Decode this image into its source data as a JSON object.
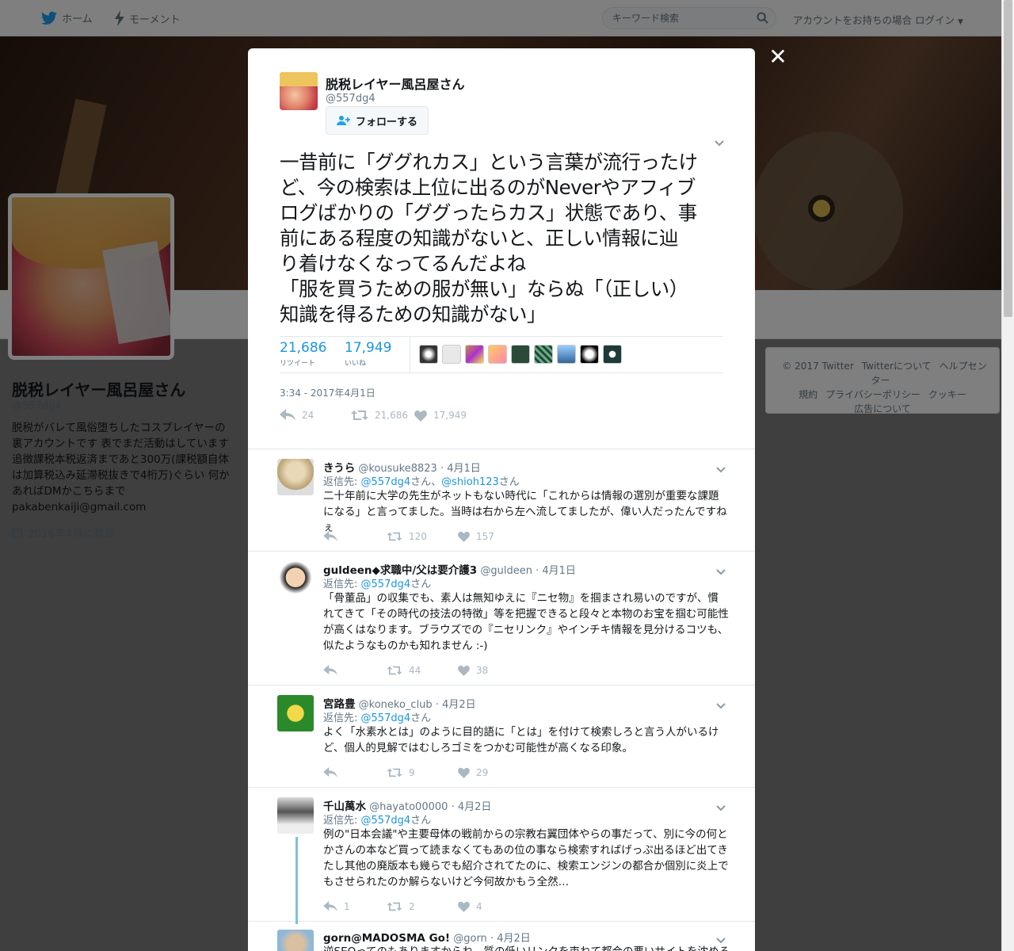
{
  "nav": {
    "home": "ホーム",
    "moments": "モーメント",
    "search_placeholder": "キーワード検索",
    "login": "アカウントをお持ちの場合 ログイン"
  },
  "profile": {
    "name": "脱税レイヤー風呂屋さん",
    "handle": "@557dg4",
    "bio": "脱税がバレて風俗堕ちしたコスプレイヤーの裏アカウントです 表でまだ活動はしています 追徴課税本税返済まであと300万(課税額自体は加算税込み延滞税抜きで4桁万)ぐらい 何かあればDMかこちらまで pakabenkaiji@gmail.com",
    "joined": "2016年4月に登録"
  },
  "footer": [
    "© 2017 Twitter",
    "Twitterについて",
    "ヘルプセンター",
    "規約",
    "プライバシーポリシー",
    "クッキー",
    "広告について"
  ],
  "tweet": {
    "name": "脱税レイヤー風呂屋さん",
    "handle": "@557dg4",
    "follow": "フォローする",
    "text_lines": [
      "一昔前に「ググれカス」という言葉が流行ったけ",
      "ど、今の検索は上位に出るのがNeverやアフィブ",
      "ログばかりの「ググったらカス」状態であり、事",
      "前にある程度の知識がないと、正しい情報に辿",
      "り着けなくなってるんだよね",
      "「服を買うための服が無い」ならぬ「（正しい）",
      "知識を得るための知識がない」"
    ],
    "retweets": "21,686",
    "retweets_label": "リツイート",
    "likes": "17,949",
    "likes_label": "いいね",
    "time": "3:34 - 2017年4月1日",
    "actions": {
      "reply": "24",
      "retweet": "21,686",
      "like": "17,949"
    }
  },
  "colors": {
    "accent": "#1b95e0",
    "muted": "#657786",
    "action": "#aab8c2",
    "thread": "#80c1d8"
  },
  "replies": [
    {
      "name": "きうら",
      "handle": "@kousuke8823",
      "date": "· 4月1日",
      "to_prefix": "返信先:",
      "to1": "@557dg4",
      "mid": "さん、",
      "to2": "@shioh123",
      "suffix": "さん",
      "text": "二十年前に大学の先生がネットもない時代に「これからは情報の選別が重要な課題になる」と言ってました。当時は右から左へ流してましたが、偉い人だったんですねぇ",
      "reply": "",
      "retweet": "120",
      "like": "157"
    },
    {
      "name": "guldeen◆求職中/父は要介護3",
      "handle": "@guldeen",
      "date": "· 4月1日",
      "to_prefix": "返信先:",
      "to1": "@557dg4",
      "suffix": "さん",
      "text": "「骨董品」の収集でも、素人は無知ゆえに『ニセ物』を掴まされ易いのですが、慣れてきて「その時代の技法の特徴」等を把握できると段々と本物のお宝を掴む可能性が高くはなります。ブラウズでの『ニセリンク』やインチキ情報を見分けるコツも、似たようなものかも知れません :-)",
      "reply": "",
      "retweet": "44",
      "like": "38"
    },
    {
      "name": "宮路豊",
      "handle": "@koneko_club",
      "date": "· 4月2日",
      "to_prefix": "返信先:",
      "to1": "@557dg4",
      "suffix": "さん",
      "text": "よく「水素水とは」のように目的語に「とは」を付けて検索しろと言う人がいるけど、個人的見解ではむしろゴミをつかむ可能性が高くなる印象。",
      "reply": "",
      "retweet": "9",
      "like": "29"
    },
    {
      "name": "千山萬水",
      "handle": "@hayato00000",
      "date": "· 4月2日",
      "to_prefix": "返信先:",
      "to1": "@557dg4",
      "suffix": "さん",
      "text": "例の\"日本会議\"や主要母体の戦前からの宗教右翼団体やらの事だって、別に今の何とかさんの本など買って読まなくてもあの位の事なら検索すればげっぷ出るほど出てきたし其他の廃版本も幾らでも紹介されてたのに、検索エンジンの都合か個別に炎上でもさせられたのか解らないけど今何故かもう全然…",
      "reply": "1",
      "retweet": "2",
      "like": "4"
    },
    {
      "name": "gorn@MADOSMA Go!",
      "handle": "@gorn",
      "date": "· 4月2日",
      "text": "逆SEOってのもありますからね。質の低いリンクを束ねて都合の悪いサイトを沈める",
      "reply": "",
      "retweet": "",
      "like": ""
    }
  ]
}
